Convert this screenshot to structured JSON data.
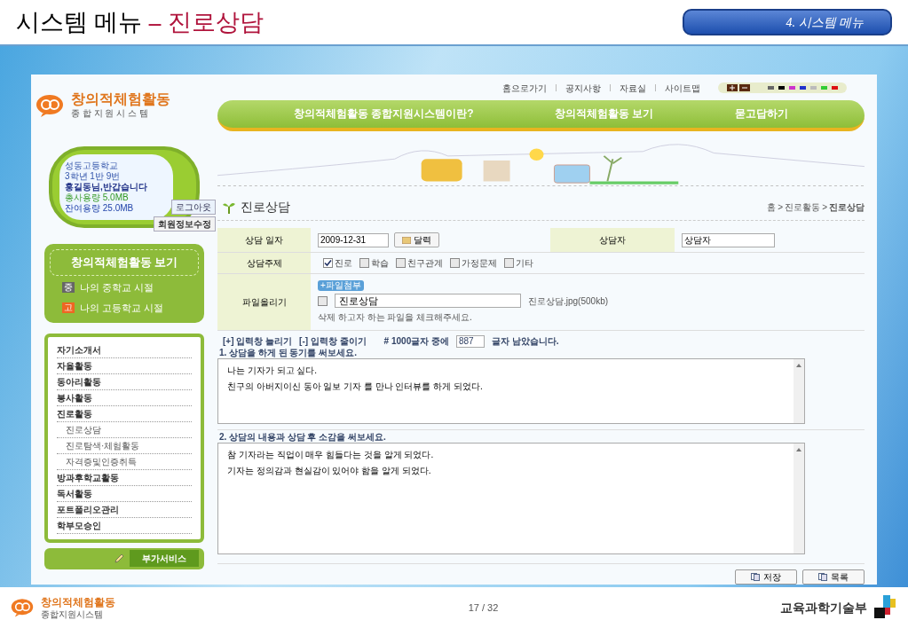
{
  "slide": {
    "title": "시스템 메뉴",
    "title_separator": "–",
    "title_highlight": "진로상담",
    "section_badge": "4. 시스템 메뉴",
    "page_number": "17 / 32",
    "footer_logo_title": "창의적체험활동",
    "footer_logo_subtitle": "종합지원시스템",
    "ministry": "교육과학기술부"
  },
  "site": {
    "logo_title": "창의적체험활동",
    "logo_subtitle": "종 합 지 원 시 스 템",
    "top_links": [
      "홈으로가기",
      "공지사항",
      "자료실",
      "사이트맵"
    ],
    "color_swatches": [
      {
        "color": "#666666"
      },
      {
        "color": "#000000"
      },
      {
        "color": "#cc33cc"
      },
      {
        "color": "#2233cc"
      },
      {
        "color": "#bbbbbb"
      },
      {
        "color": "#33cc33"
      },
      {
        "color": "#dd1111"
      }
    ],
    "main_nav": [
      "창의적체험활동 종합지원시스템이란?",
      "창의적체험활동 보기",
      "묻고답하기"
    ],
    "profile": {
      "school": "성동고등학교",
      "class": "3학년 1반 9번",
      "greeting": "홍길동님,반갑습니다",
      "total_usage": "총사용량 5.0MB",
      "remaining": "잔여용량 25.0MB",
      "logout": "로그아웃",
      "edit_info": "회원정보수정"
    },
    "side_header": "창의적체험활동 보기",
    "school_links": [
      {
        "badge": "중",
        "label": "나의 중학교 시절",
        "color": "#666666"
      },
      {
        "badge": "고",
        "label": "나의 고등학교 시절",
        "color": "#ee6622"
      }
    ],
    "side_menu": [
      {
        "label": "자기소개서"
      },
      {
        "label": "자율활동"
      },
      {
        "label": "동아리활동"
      },
      {
        "label": "봉사활동"
      },
      {
        "label": "진로활동",
        "children": [
          {
            "label": "진로상담"
          },
          {
            "label": "진로탐색·체험활동"
          },
          {
            "label": "자격증및인증취득"
          }
        ]
      },
      {
        "label": "방과후학교활동"
      },
      {
        "label": "독서활동"
      },
      {
        "label": "포트폴리오관리"
      },
      {
        "label": "학부모승인"
      }
    ],
    "service_button": "부가서비스"
  },
  "content": {
    "title": "진로상담",
    "breadcrumb": [
      "홈",
      "진로활동",
      "진로상담"
    ],
    "breadcrumb_separator": ">",
    "date_label": "상담 일자",
    "date_value": "2009-12-31",
    "calendar_button": "달력",
    "counselor_label": "상담자",
    "counselor_value": "상담자",
    "topic_label": "상담주제",
    "topics": [
      {
        "label": "진로",
        "checked": true
      },
      {
        "label": "학습",
        "checked": false
      },
      {
        "label": "친구관계",
        "checked": false
      },
      {
        "label": "가정문제",
        "checked": false
      },
      {
        "label": "기타",
        "checked": false
      }
    ],
    "file_label": "파일올리기",
    "attach_button": "+파일첨부",
    "file_checked": false,
    "file_name": "진로상담",
    "file_info": "진로상담.jpg(500kb)",
    "file_hint": "삭제 하고자 하는 파일을 체크해주세요.",
    "expand_link": "[+] 입력창 늘리기",
    "shrink_link": "[-] 입력창 줄이기",
    "counter_prefix": "# 1000글자 중에",
    "counter_value": "887",
    "counter_suffix": "글자 남았습니다.",
    "questions": [
      {
        "label": "1. 상담을 하게 된 동기를 써보세요.",
        "lines": [
          "나는 기자가 되고 싶다.",
          "친구의 아버지이신 동아 일보 기자 를 만나 인터뷰를 하게 되었다."
        ]
      },
      {
        "label": "2. 상담의 내용과 상담 후 소감을 써보세요.",
        "lines": [
          "참 기자라는 직업이 매우 힘들다는 것을 알게 되었다.",
          "기자는 정의감과 현실감이 있어야 함을 알게 되었다."
        ]
      }
    ],
    "buttons": [
      "저장",
      "목록"
    ]
  }
}
